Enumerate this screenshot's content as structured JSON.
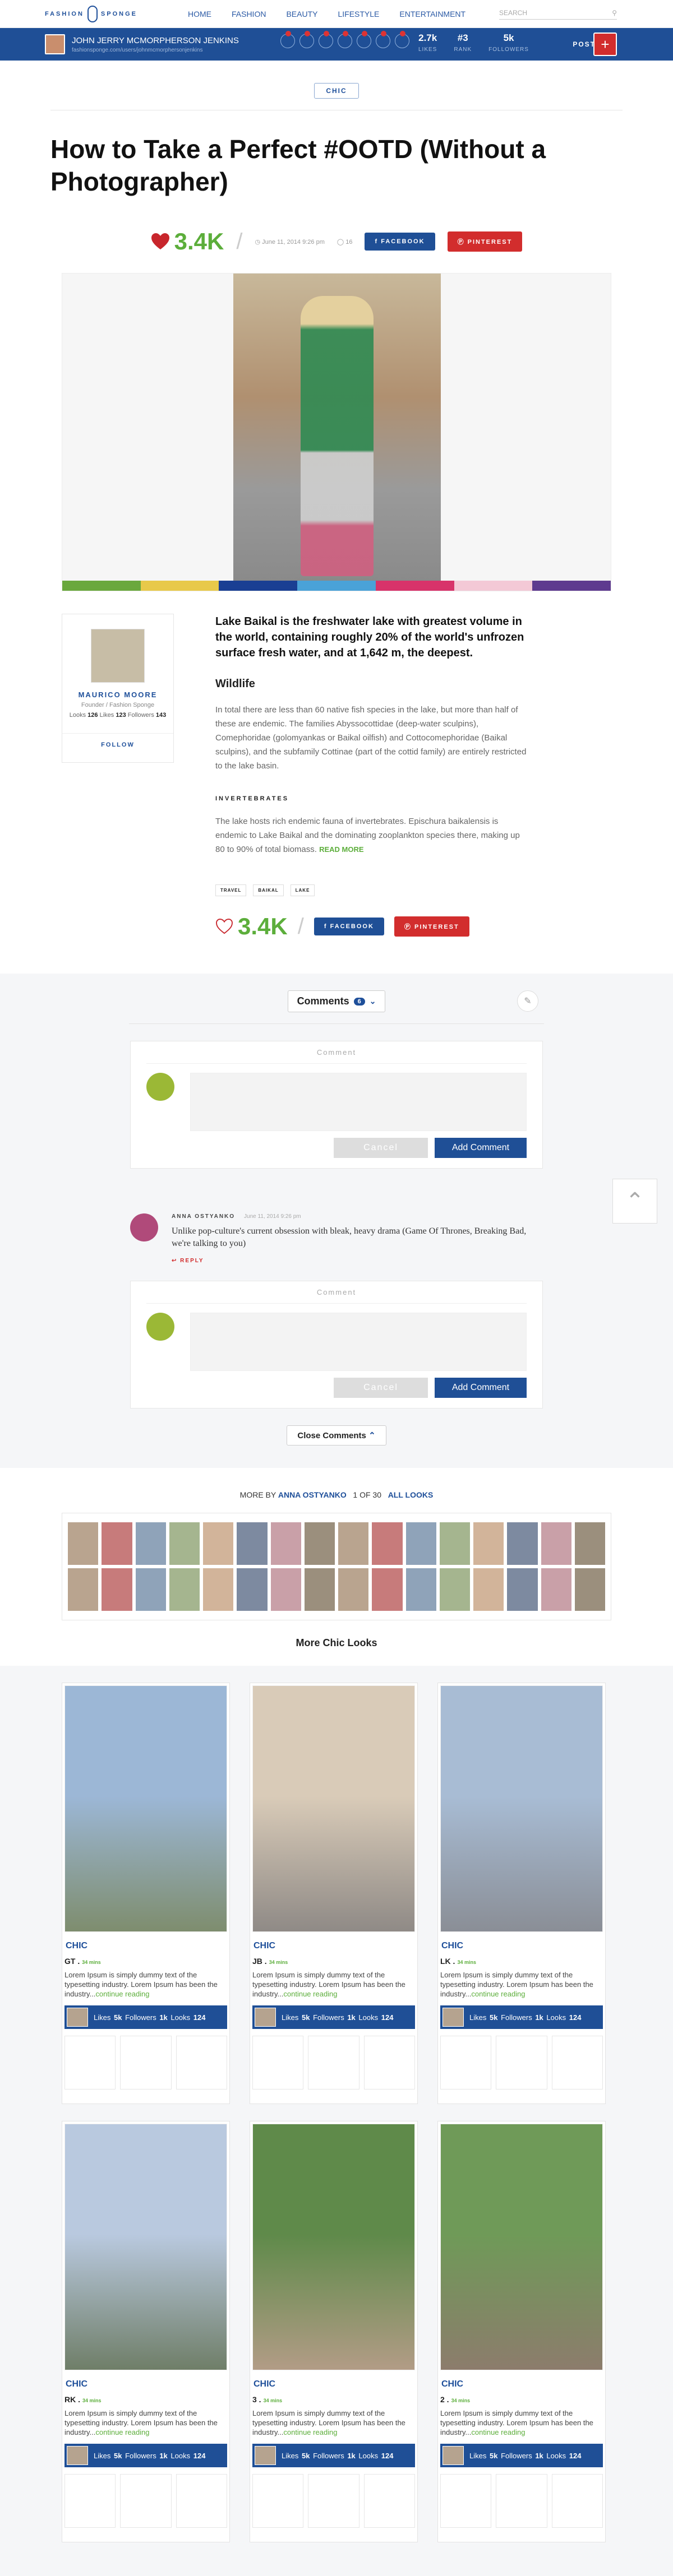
{
  "nav": {
    "logo_left": "FASHION",
    "logo_right": "SPONGE",
    "items": [
      "HOME",
      "FASHION",
      "BEAUTY",
      "LIFESTYLE",
      "ENTERTAINMENT"
    ],
    "search_placeholder": "SEARCH"
  },
  "userbar": {
    "name": "JOHN JERRY MCMORPHERSON JENKINS",
    "url": "fashionsponge.com/users/johnmcmorphersonjenkins",
    "likes_value": "2.7k",
    "likes_label": "LIKES",
    "rank_value": "#3",
    "rank_label": "RANK",
    "followers_value": "5k",
    "followers_label": "FOLLOWERS",
    "post_label": "POST",
    "plus_label": "+"
  },
  "article": {
    "category": "CHIC",
    "title": "How to Take a Perfect #OOTD (Without a Photographer)",
    "score": "3.4K",
    "date": "June 11, 2014 9:26 pm",
    "comment_count": "16",
    "facebook_label": "FACEBOOK",
    "pinterest_label": "PINTEREST",
    "colors": [
      "#6aa83d",
      "#e8c94a",
      "#1a3f93",
      "#4aa2d8",
      "#d8336a",
      "#f3c9d6",
      "#5e3a8f"
    ],
    "lead": "Lake Baikal is the freshwater lake with greatest volume in the world, containing roughly 20% of the world's unfrozen surface fresh water, and at 1,642 m, the deepest.",
    "h_wildlife": "Wildlife",
    "p1": "In total there are less than 60 native fish species in the lake, but more than half of these are endemic. The families Abyssocottidae (deep-water sculpins), Comephoridae (golomyankas or Baikal oilfish) and Cottocomephoridae (Baikal sculpins), and the subfamily Cottinae (part of the cottid family) are entirely restricted to the lake basin.",
    "h_invertebrates": "INVERTEBRATES",
    "p2": "The lake hosts rich endemic fauna of invertebrates. Epischura baikalensis is endemic to Lake Baikal and the dominating zooplankton species there, making up 80 to 90% of total biomass.",
    "read_more": "READ MORE",
    "tags": [
      "TRAVEL",
      "BAIKAL",
      "LAKE"
    ]
  },
  "author": {
    "name": "MAURICO MOORE",
    "role": "Founder / Fashion Sponge",
    "looks_label": "Looks",
    "looks": "126",
    "likes_label": "Likes",
    "likes": "123",
    "followers_label": "Followers",
    "followers": "143",
    "follow": "FOLLOW"
  },
  "comments": {
    "title": "Comments",
    "count": "6",
    "box_label": "Comment",
    "cancel": "Cancel",
    "add": "Add Comment",
    "item_author": "ANNA OSTYANKO",
    "item_date": "June 11, 2014 9:26 pm",
    "item_text": "Unlike pop-culture's current obsession with bleak, heavy drama (Game Of Thrones, Breaking Bad, we're talking to you)",
    "reply": "REPLY",
    "close": "Close Comments"
  },
  "more_by": {
    "prefix": "MORE BY",
    "author": "ANNA OSTYANKO",
    "pager": "1 OF 30",
    "all": "ALL LOOKS"
  },
  "more_looks_title": "More Chic Looks",
  "looks": [
    {
      "cat": "CHIC",
      "who": "GT .",
      "mins": "34 mins",
      "desc": "Lorem Ipsum is simply dummy text of the typesetting industry. Lorem Ipsum has been the industry...",
      "more": "continue reading",
      "likes": "5k",
      "followers": "1k",
      "looks": "124",
      "img_a": "#9cb7d6",
      "img_b": "#7e8d6e"
    },
    {
      "cat": "CHIC",
      "who": "JB .",
      "mins": "34 mins",
      "desc": "Lorem Ipsum is simply dummy text of the typesetting industry. Lorem Ipsum has been the industry...",
      "more": "continue reading",
      "likes": "5k",
      "followers": "1k",
      "looks": "124",
      "img_a": "#d9cbb8",
      "img_b": "#8f8a86"
    },
    {
      "cat": "CHIC",
      "who": "LK .",
      "mins": "34 mins",
      "desc": "Lorem Ipsum is simply dummy text of the typesetting industry. Lorem Ipsum has been the industry...",
      "more": "continue reading",
      "likes": "5k",
      "followers": "1k",
      "looks": "124",
      "img_a": "#a8bcd4",
      "img_b": "#8a8e96"
    },
    {
      "cat": "CHIC",
      "who": "RK .",
      "mins": "34 mins",
      "desc": "Lorem Ipsum is simply dummy text of the typesetting industry. Lorem Ipsum has been the industry...",
      "more": "continue reading",
      "likes": "5k",
      "followers": "1k",
      "looks": "124",
      "img_a": "#b9c9df",
      "img_b": "#6f7e68"
    },
    {
      "cat": "CHIC",
      "who": "3 .",
      "mins": "34 mins",
      "desc": "Lorem Ipsum is simply dummy text of the typesetting industry. Lorem Ipsum has been the industry...",
      "more": "continue reading",
      "likes": "5k",
      "followers": "1k",
      "looks": "124",
      "img_a": "#5f8a4a",
      "img_b": "#b29c86"
    },
    {
      "cat": "CHIC",
      "who": "2 .",
      "mins": "34 mins",
      "desc": "Lorem Ipsum is simply dummy text of the typesetting industry. Lorem Ipsum has been the industry...",
      "more": "continue reading",
      "likes": "5k",
      "followers": "1k",
      "looks": "124",
      "img_a": "#6f9a58",
      "img_b": "#8c7c6c"
    }
  ],
  "looks_labels": {
    "likes": "Likes",
    "followers": "Followers",
    "looks": "Looks"
  }
}
